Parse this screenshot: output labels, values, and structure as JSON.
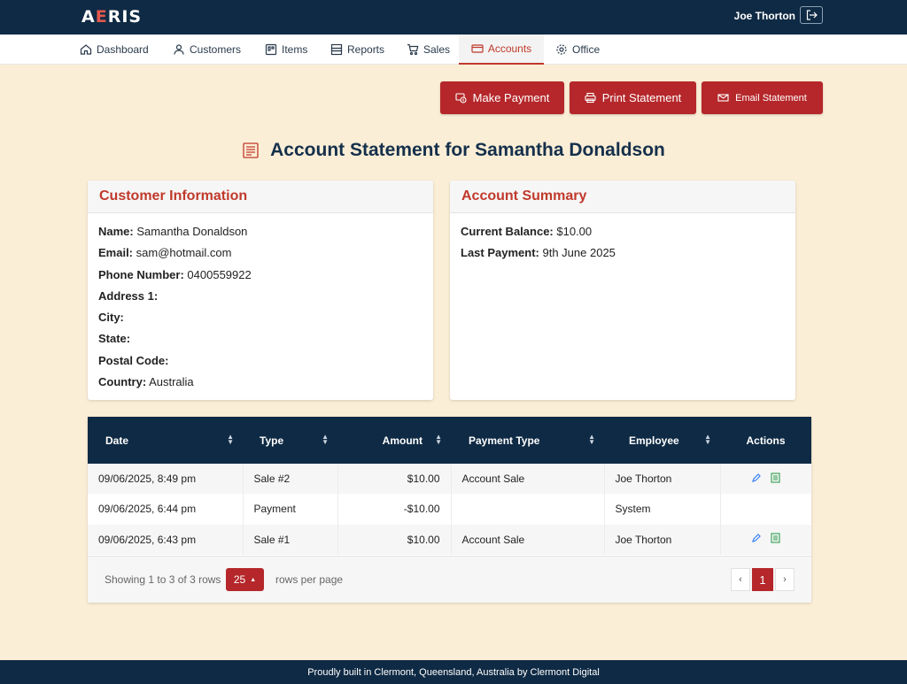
{
  "brand": {
    "logo_prefix": "A",
    "logo_accent": "E",
    "logo_suffix": "RIS"
  },
  "user": {
    "name": "Joe Thorton"
  },
  "nav": [
    {
      "label": "Dashboard",
      "icon": "home-icon"
    },
    {
      "label": "Customers",
      "icon": "user-icon"
    },
    {
      "label": "Items",
      "icon": "items-icon"
    },
    {
      "label": "Reports",
      "icon": "reports-icon"
    },
    {
      "label": "Sales",
      "icon": "cart-icon"
    },
    {
      "label": "Accounts",
      "icon": "card-icon",
      "active": true
    },
    {
      "label": "Office",
      "icon": "gear-icon"
    }
  ],
  "actions": {
    "make_payment": "Make Payment",
    "print_statement": "Print Statement",
    "email_statement": "Email Statement"
  },
  "page_title": "Account Statement for Samantha Donaldson",
  "customer_info": {
    "heading": "Customer Information",
    "fields": [
      {
        "label": "Name:",
        "value": "Samantha Donaldson"
      },
      {
        "label": "Email:",
        "value": "sam@hotmail.com"
      },
      {
        "label": "Phone Number:",
        "value": "0400559922"
      },
      {
        "label": "Address 1:",
        "value": ""
      },
      {
        "label": "City:",
        "value": ""
      },
      {
        "label": "State:",
        "value": ""
      },
      {
        "label": "Postal Code:",
        "value": ""
      },
      {
        "label": "Country:",
        "value": "Australia"
      }
    ]
  },
  "account_summary": {
    "heading": "Account Summary",
    "fields": [
      {
        "label": "Current Balance:",
        "value": "$10.00"
      },
      {
        "label": "Last Payment:",
        "value": "9th June 2025"
      }
    ]
  },
  "table": {
    "columns": [
      "Date",
      "Type",
      "Amount",
      "Payment Type",
      "Employee",
      "Actions"
    ],
    "rows": [
      {
        "date": "09/06/2025, 8:49 pm",
        "type": "Sale #2",
        "amount": "$10.00",
        "payment_type": "Account Sale",
        "employee": "Joe Thorton",
        "has_actions": true
      },
      {
        "date": "09/06/2025, 6:44 pm",
        "type": "Payment",
        "amount": "-$10.00",
        "payment_type": "",
        "employee": "System",
        "has_actions": false
      },
      {
        "date": "09/06/2025, 6:43 pm",
        "type": "Sale #1",
        "amount": "$10.00",
        "payment_type": "Account Sale",
        "employee": "Joe Thorton",
        "has_actions": true
      }
    ],
    "showing": "Showing 1 to 3 of 3 rows",
    "page_size": "25",
    "rows_per_page": "rows per page",
    "prev": "‹",
    "current_page": "1",
    "next": "›"
  },
  "footer": "Proudly built in Clermont, Queensland, Australia by Clermont Digital",
  "colors": {
    "navy": "#0f2a44",
    "accent": "#b5272a",
    "background": "#fbeed6"
  }
}
